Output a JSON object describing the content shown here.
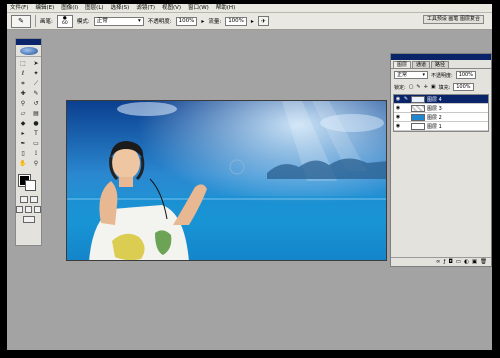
{
  "menu": [
    "文件(F)",
    "编辑(E)",
    "图像(I)",
    "图层(L)",
    "选择(S)",
    "滤镜(T)",
    "视图(V)",
    "窗口(W)",
    "帮助(H)"
  ],
  "options": {
    "brush_label": "画笔:",
    "brush_size": "60",
    "mode_label": "模式:",
    "mode_value": "正常",
    "opacity_label": "不透明度:",
    "opacity_value": "100%",
    "flow_label": "流量:",
    "flow_value": "100%"
  },
  "palette_well_button": "工具预设 画笔 图层复合",
  "layers_panel": {
    "tabs": [
      "图层",
      "通道",
      "路径"
    ],
    "blend_mode": "正常",
    "opacity_label": "不透明度:",
    "opacity_value": "100%",
    "lock_label": "锁定:",
    "fill_label": "填充:",
    "fill_value": "100%",
    "layers": [
      {
        "name": "图层 4",
        "selected": true
      },
      {
        "name": "图层 3",
        "selected": false
      },
      {
        "name": "图层 2",
        "selected": false
      },
      {
        "name": "图层 1",
        "selected": false
      }
    ]
  }
}
